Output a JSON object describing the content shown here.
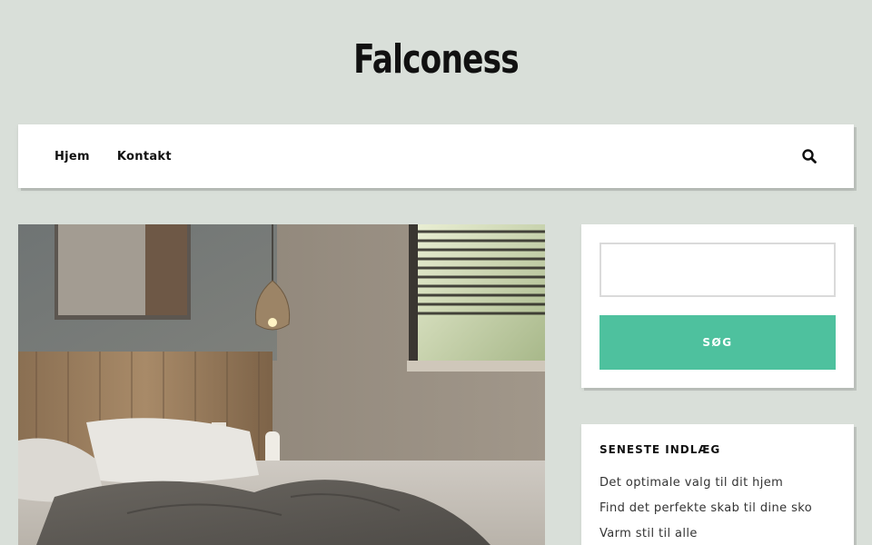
{
  "site": {
    "title": "Falconess"
  },
  "nav": {
    "items": [
      {
        "label": "Hjem"
      },
      {
        "label": "Kontakt"
      }
    ],
    "search_icon": "search-icon"
  },
  "hero": {
    "image": "bedroom-photo"
  },
  "search_widget": {
    "input_value": "",
    "button_label": "SØG"
  },
  "recent_posts": {
    "title": "SENESTE INDLÆG",
    "items": [
      {
        "label": "Det optimale valg til dit hjem"
      },
      {
        "label": "Find det perfekte skab til dine sko"
      },
      {
        "label": "Varm stil til alle"
      }
    ]
  },
  "colors": {
    "background": "#d9dfd9",
    "accent": "#4ec19e"
  }
}
